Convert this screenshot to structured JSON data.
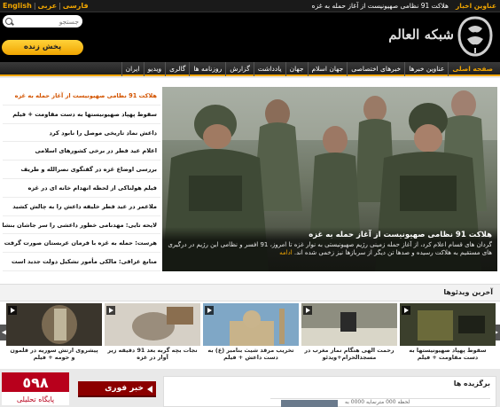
{
  "header": {
    "languages": [
      "English",
      "فارسی",
      "عربی"
    ],
    "top_news_label": "عناوین اخبار",
    "top_news_text": "هلاکت 91 نظامی صهیونیست از آغاز حمله به غزه",
    "search_placeholder": "جستجو",
    "live_button": "پخش زنده",
    "logo_text": "شبکه العالم"
  },
  "nav": {
    "items": [
      "صفحه اصلی",
      "عناوین خبرها",
      "خبرهای اختصاصی",
      "جهان اسلام",
      "جهان",
      "یادداشت",
      "گزارش",
      "روزنامه ها",
      "گالری",
      "ویدیو",
      "ایران"
    ]
  },
  "hero": {
    "title": "هلاکت 91 نظامی صهیونیست از آغاز حمله به غزه",
    "text": "گردان های قسام اعلام کرد، از آغاز حمله زمینی رژیم صهیونیستی به نوار غزه تا امروز، 91 افسر و نظامی این رژیم در درگیری های مستقیم به هلاکت رسیده و صدها تن دیگر از سربازها نیز زخمی شده اند.",
    "more": "ادامه"
  },
  "news_list": [
    "هلاکت 91 نظامی صهیونیست از آغاز حمله به غزه",
    "سقوط پهپاد صهیونیستها به دست مقاومت + فیلم",
    "داعش نماد تاریخی موصل را نابود کرد",
    "اعلام عید فطر در برخی کشورهای اسلامی",
    "بررسی اوضاع غزه در گفتگوی نصرالله و طریف",
    "فیلم هولناکی از لحظه انهدام خانه ای در غزه",
    "ملاعمر در عید فطر خلیفه داعش را به چالش کشید",
    "لایحه تایی: مهدنامی خطور داعشی را سر جاشان بنشانیم",
    "هرست: حمله به غزه با فرمان عربستان صورت گرفت",
    "منابع عراقی: مالکی مأمور تشکیل دولت جدید است"
  ],
  "videos": {
    "header": "آخرین ویدئوها",
    "items": [
      "سقوط پهپاد صهیونیستها به دست مقاومت + فیلم",
      "رحمت الهی هنگام نماز مغرب در مسجدالحرام+ویدئو",
      "تخریب مرقد شیث بنامبر (ع) به دست داعش + فیلم",
      "نجات بچه گربه بعد 91 دقیقه زیر آوار در غزه",
      "گفتگوی نوجوانان با ترور در غزه + فیلم",
      "پیشروی ارتش سوریه در قلمون و حومه + فیلم"
    ]
  },
  "bottom": {
    "breaking": "خبر فوری",
    "featured": "برگزیده ها",
    "featured_snippet": "لحظه 000 مترنمایه 0000 به"
  }
}
